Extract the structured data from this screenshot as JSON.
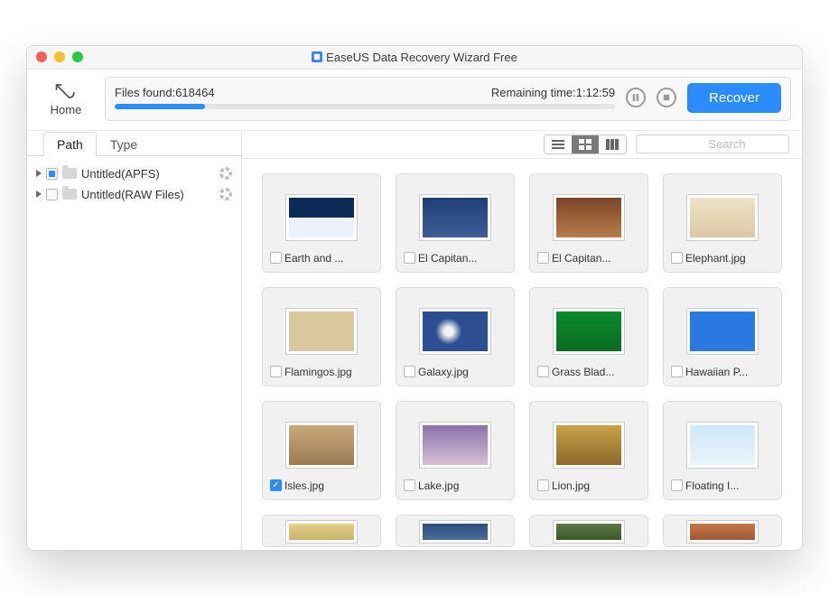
{
  "window": {
    "title": "EaseUS Data Recovery Wizard Free"
  },
  "toolbar": {
    "home_label": "Home",
    "files_found_label": "Files found:",
    "files_found_value": "618464",
    "remaining_label": "Remaining time:",
    "remaining_value": "1:12:59",
    "recover_label": "Recover"
  },
  "sidebar": {
    "tabs": {
      "path": "Path",
      "type": "Type"
    },
    "items": [
      {
        "label": "Untitled(APFS)",
        "indeterminate": true,
        "loading": true
      },
      {
        "label": "Untitled(RAW Files)",
        "indeterminate": false,
        "loading": true
      }
    ]
  },
  "search": {
    "placeholder": "Search"
  },
  "files": [
    {
      "name": "Earth and ...",
      "checked": false,
      "thumb": "t-earth"
    },
    {
      "name": "El Capitan...",
      "checked": false,
      "thumb": "t-cap1"
    },
    {
      "name": "El Capitan...",
      "checked": false,
      "thumb": "t-cap2"
    },
    {
      "name": "Elephant.jpg",
      "checked": false,
      "thumb": "t-elephant"
    },
    {
      "name": "Flamingos.jpg",
      "checked": false,
      "thumb": "t-flam"
    },
    {
      "name": "Galaxy.jpg",
      "checked": false,
      "thumb": "t-galaxy"
    },
    {
      "name": "Grass Blad...",
      "checked": false,
      "thumb": "t-grass"
    },
    {
      "name": "Hawaiian P...",
      "checked": false,
      "thumb": "t-haw"
    },
    {
      "name": "Isles.jpg",
      "checked": true,
      "thumb": "t-isles"
    },
    {
      "name": "Lake.jpg",
      "checked": false,
      "thumb": "t-lake"
    },
    {
      "name": "Lion.jpg",
      "checked": false,
      "thumb": "t-lion"
    },
    {
      "name": "Floating I...",
      "checked": false,
      "thumb": "t-float"
    }
  ],
  "partial_files": [
    {
      "thumb": "t-p1"
    },
    {
      "thumb": "t-p2"
    },
    {
      "thumb": "t-p3"
    },
    {
      "thumb": "t-p4"
    }
  ]
}
